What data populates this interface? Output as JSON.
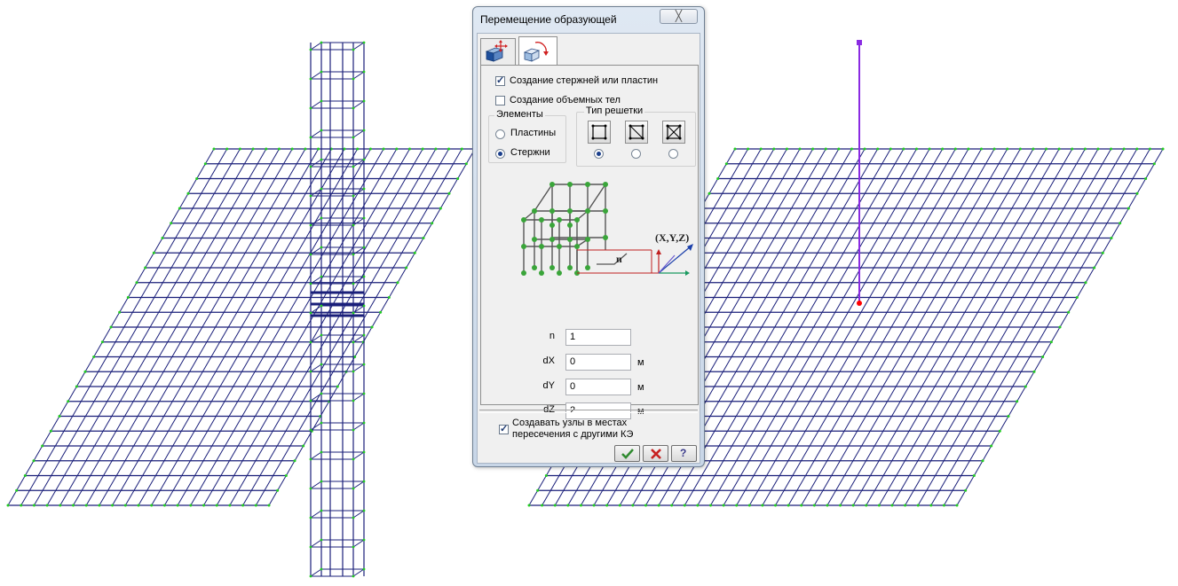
{
  "dialog": {
    "title": "Перемещение образующей",
    "close_label": "╳",
    "tabs": [
      {
        "name": "move-tab",
        "icon": "move-arrows-icon"
      },
      {
        "name": "rotate-tab",
        "icon": "rotate-cube-icon"
      }
    ],
    "create_bars_label": "Создание стержней или пластин",
    "create_bars_checked": true,
    "create_solids_label": "Создание объемных тел",
    "create_solids_checked": false,
    "elements_group": {
      "title": "Элементы",
      "options": [
        "Пластины",
        "Стержни"
      ],
      "selected": "Стержни"
    },
    "grid_type_group": {
      "title": "Тип решетки",
      "options": [
        "grid-no-diagonal-icon",
        "grid-single-diagonal-icon",
        "grid-cross-diagonal-icon"
      ],
      "selected_index": 0
    },
    "diagram": {
      "coord_label": "(X,Y,Z)",
      "n_label": "n"
    },
    "fields": {
      "n": {
        "label": "n",
        "value": "1",
        "unit": ""
      },
      "dx": {
        "label": "dX",
        "value": "0",
        "unit": "м"
      },
      "dy": {
        "label": "dY",
        "value": "0",
        "unit": "м"
      },
      "dz": {
        "label": "dZ",
        "value": "2",
        "unit": "м"
      }
    },
    "create_nodes_label_line1": "Создавать узлы в местах",
    "create_nodes_label_line2": "пересечения с другими КЭ",
    "create_nodes_checked": true,
    "buttons": {
      "ok": "ok-check-icon",
      "cancel": "cancel-x-icon",
      "help": "?"
    }
  },
  "colors": {
    "mesh_line": "#1a1f7a",
    "node": "#22cc22",
    "vertical_bar": "#8a2be2",
    "selected_node": "#ff0000",
    "dialog_frame": "#c8d6e7"
  }
}
